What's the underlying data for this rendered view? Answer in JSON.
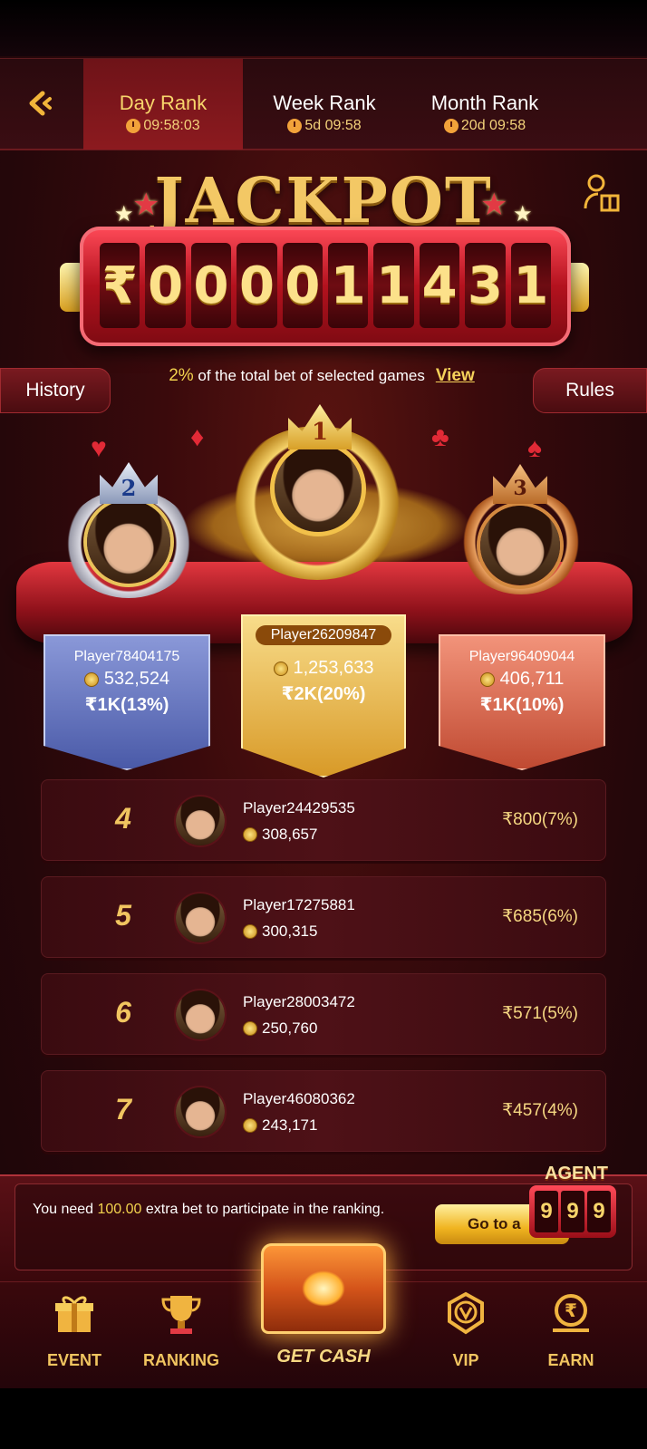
{
  "tabs": [
    {
      "label": "Day Rank",
      "time": "09:58:03",
      "active": true
    },
    {
      "label": "Week Rank",
      "time": "5d 09:58",
      "active": false
    },
    {
      "label": "Month Rank",
      "time": "20d 09:58",
      "active": false
    }
  ],
  "jackpot": {
    "title": "JACKPOT",
    "digits": [
      "₹",
      "0",
      "0",
      "0",
      "0",
      "1",
      "1",
      "4",
      "3",
      "1"
    ]
  },
  "rule": {
    "percent": "2%",
    "text": " of the total bet of selected games",
    "view_label": "View"
  },
  "buttons": {
    "history": "History",
    "rules": "Rules"
  },
  "top3": [
    {
      "rank": "1",
      "name": "Player26209847",
      "coins": "1,253,633",
      "payout": "₹2K(20%)"
    },
    {
      "rank": "2",
      "name": "Player78404175",
      "coins": "532,524",
      "payout": "₹1K(13%)"
    },
    {
      "rank": "3",
      "name": "Player96409044",
      "coins": "406,711",
      "payout": "₹1K(10%)"
    }
  ],
  "rows": [
    {
      "rank": "4",
      "name": "Player24429535",
      "coins": "308,657",
      "payout": "₹800(7%)"
    },
    {
      "rank": "5",
      "name": "Player17275881",
      "coins": "300,315",
      "payout": "₹685(6%)"
    },
    {
      "rank": "6",
      "name": "Player28003472",
      "coins": "250,760",
      "payout": "₹571(5%)"
    },
    {
      "rank": "7",
      "name": "Player46080362",
      "coins": "243,171",
      "payout": "₹457(4%)"
    }
  ],
  "notice": {
    "pre": "You need ",
    "amount": "100.00",
    "post": " extra bet to participate in the ranking.",
    "button": "Go to a"
  },
  "agent": {
    "label": "AGENT",
    "slots": [
      "9",
      "9",
      "9"
    ]
  },
  "nav": {
    "event": "EVENT",
    "ranking": "RANKING",
    "getcash": "GET CASH",
    "vip": "VIP",
    "earn": "EARN"
  },
  "colors": {
    "gold": "#f1c560",
    "accent_red": "#b3121e",
    "bg": "#25070a"
  }
}
